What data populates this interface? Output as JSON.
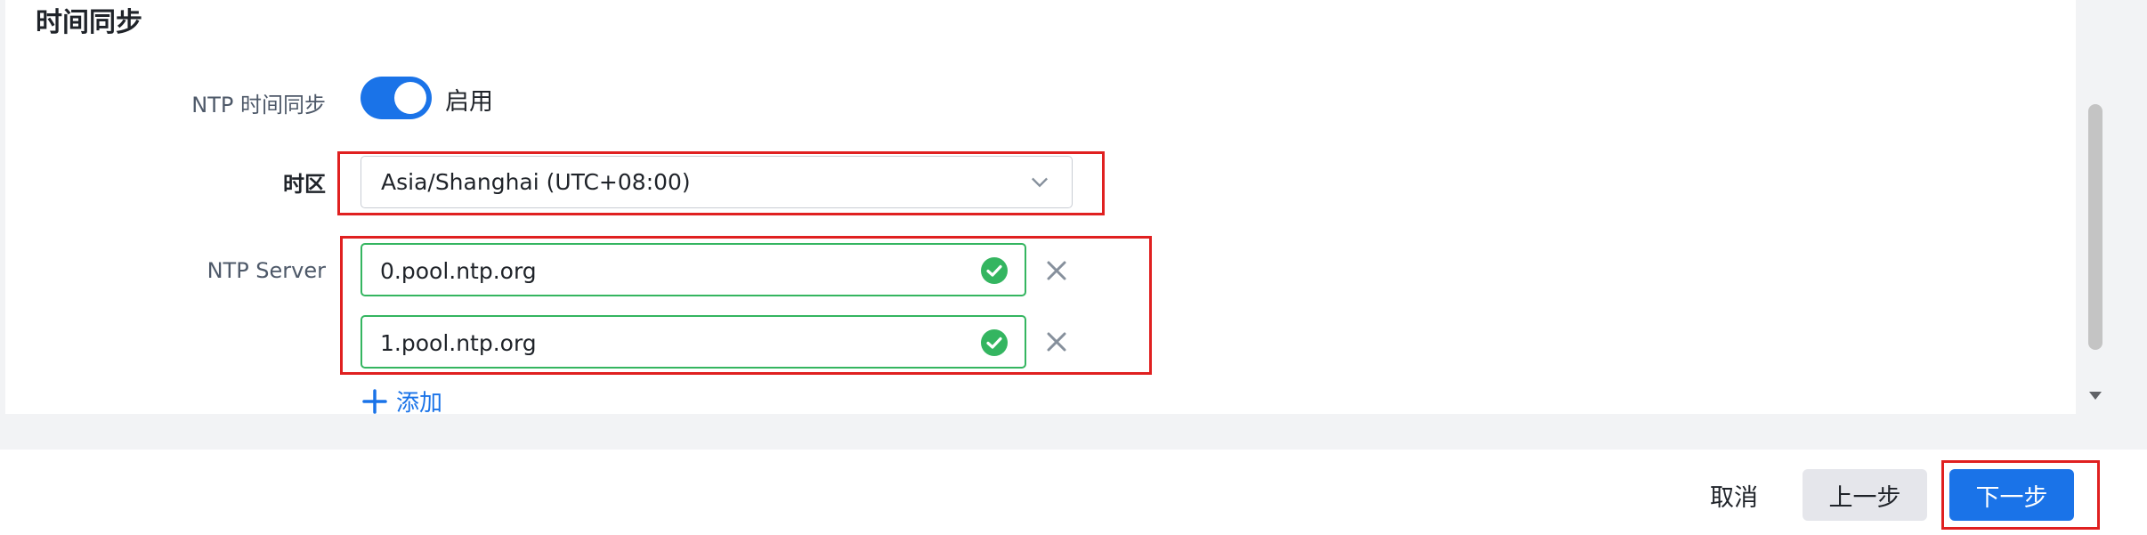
{
  "section": {
    "title": "时间同步"
  },
  "ntp_sync": {
    "label": "NTP 时间同步",
    "toggle_on": true,
    "toggle_text": "启用"
  },
  "timezone": {
    "label": "时区",
    "value": "Asia/Shanghai (UTC+08:00)"
  },
  "ntp_server": {
    "label": "NTP Server",
    "servers": [
      "0.pool.ntp.org",
      "1.pool.ntp.org"
    ],
    "add_label": "添加"
  },
  "footer": {
    "cancel_label": "取消",
    "prev_label": "上一步",
    "next_label": "下一步"
  },
  "colors": {
    "accent": "#1a73e8",
    "valid": "#34b560",
    "highlight": "#e02020"
  }
}
